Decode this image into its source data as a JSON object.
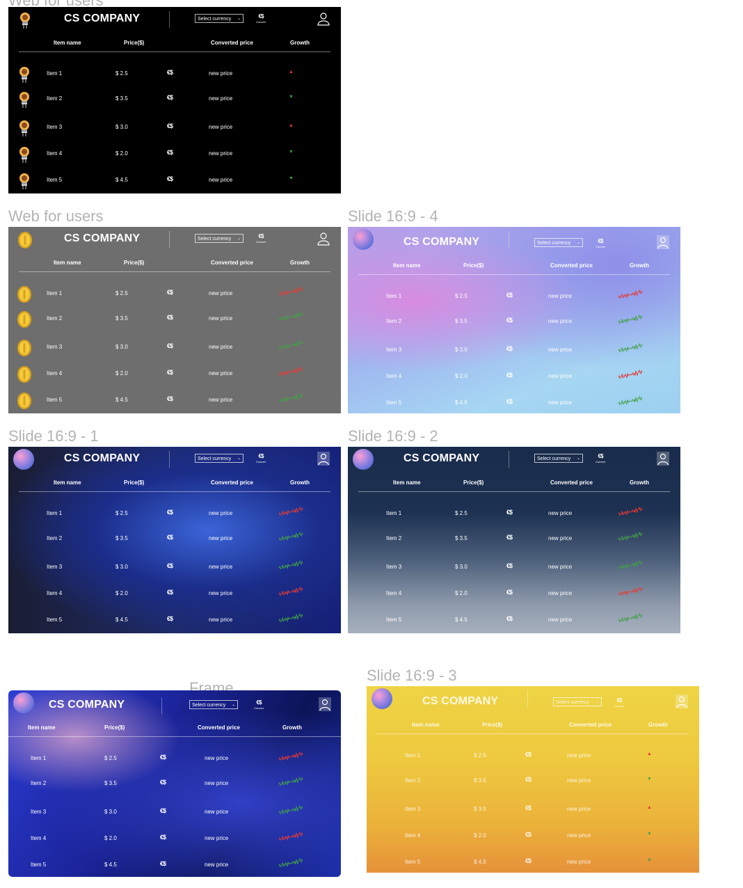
{
  "frames": [
    {
      "title": "Web for users",
      "company": "CS COMPANY",
      "select_placeholder": "Select currency",
      "convert_label": "Convert",
      "theme": "dark",
      "growth_style": "arrow",
      "logo": "bulb-icon"
    },
    {
      "title": "Web for users",
      "company": "CS COMPANY",
      "select_placeholder": "Select currency",
      "convert_label": "Convert",
      "theme": "gray",
      "growth_style": "spark",
      "logo": "coin-icon"
    },
    {
      "title": "Slide 16:9 - 4",
      "company": "CS COMPANY",
      "select_placeholder": "Select currency",
      "convert_label": "Convert",
      "theme": "pastel",
      "growth_style": "spark",
      "logo": "gradient-sphere-icon"
    },
    {
      "title": "Slide 16:9 - 1",
      "company": "CS COMPANY",
      "select_placeholder": "Select currency",
      "convert_label": "Convert",
      "theme": "jelly",
      "growth_style": "spark",
      "logo": "gradient-sphere-icon"
    },
    {
      "title": "Slide 16:9 - 2",
      "company": "CS COMPANY",
      "select_placeholder": "Select currency",
      "convert_label": "Convert",
      "theme": "navy",
      "growth_style": "spark",
      "logo": "gradient-sphere-icon"
    },
    {
      "title": "Frame",
      "company": "CS COMPANY",
      "select_placeholder": "Select currency",
      "convert_label": "Convert",
      "theme": "blue",
      "growth_style": "spark",
      "logo": "gradient-sphere-icon"
    },
    {
      "title": "Slide 16:9 - 3",
      "company": "CS COMPANY",
      "select_placeholder": "Select currency",
      "convert_label": "Convert",
      "theme": "yellow",
      "growth_style": "arrow",
      "logo": "gradient-sphere-icon"
    }
  ],
  "columns": {
    "item": "Item name",
    "price": "Price($)",
    "converted": "Converted price",
    "growth": "Growth"
  },
  "items": [
    {
      "name": "Item 1",
      "price": "$ 2.5",
      "converted": "new price",
      "trend": "up"
    },
    {
      "name": "Item 2",
      "price": "$ 3.5",
      "converted": "new price",
      "trend": "down"
    },
    {
      "name": "Item 3",
      "price": "$ 3.0",
      "converted": "new price",
      "trend": "up"
    },
    {
      "name": "Item 4",
      "price": "$ 2.0",
      "converted": "new price",
      "trend": "down"
    },
    {
      "name": "Item 5",
      "price": "$ 4.5",
      "converted": "new price",
      "trend": "down"
    }
  ],
  "convert_symbol": "€$",
  "colors": {
    "up_arrow": "#e53935",
    "down_arrow": "#43a047",
    "spark_red": "#e53935",
    "spark_green": "#43a047"
  }
}
